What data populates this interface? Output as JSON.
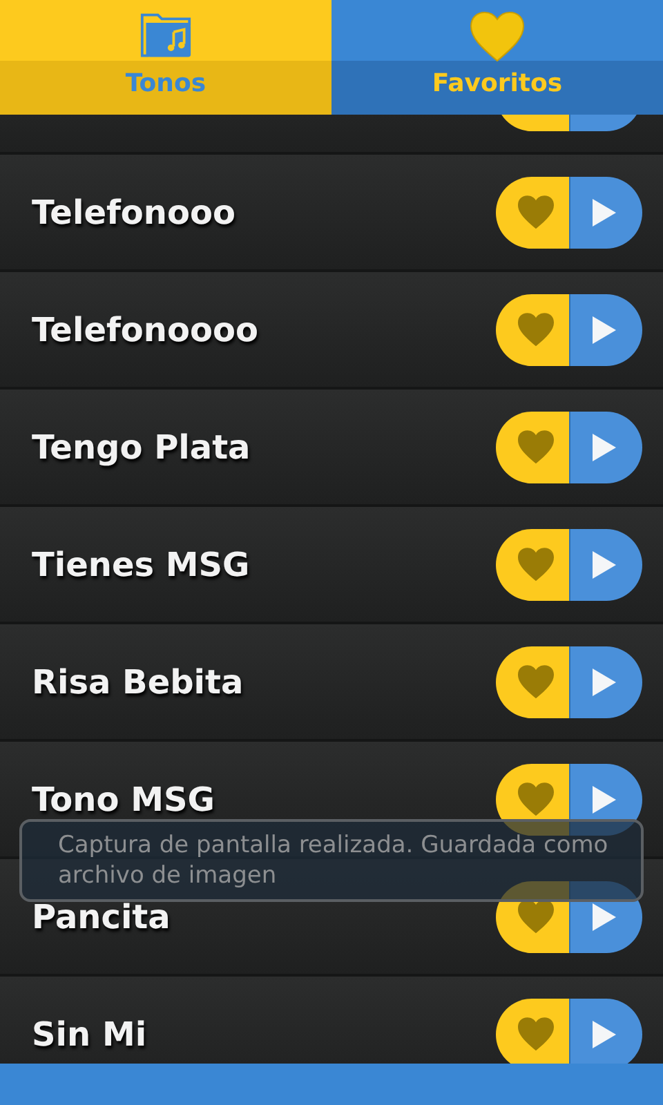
{
  "tabs": [
    {
      "label": "Tonos",
      "kind": "folder",
      "selected": true
    },
    {
      "label": "Favoritos",
      "kind": "heart",
      "selected": false
    }
  ],
  "rows": [
    {
      "title": "Telefonooo",
      "favorite": false
    },
    {
      "title": "Telefonoooo",
      "favorite": false
    },
    {
      "title": "Tengo Plata",
      "favorite": false
    },
    {
      "title": "Tienes MSG",
      "favorite": false
    },
    {
      "title": "Risa Bebita",
      "favorite": false
    },
    {
      "title": "Tono MSG",
      "favorite": false
    },
    {
      "title": "Pancita",
      "favorite": false
    },
    {
      "title": "Sin Mi",
      "favorite": false
    }
  ],
  "toast": {
    "text": "Captura de pantalla realizada. Guardada como archivo de imagen"
  }
}
